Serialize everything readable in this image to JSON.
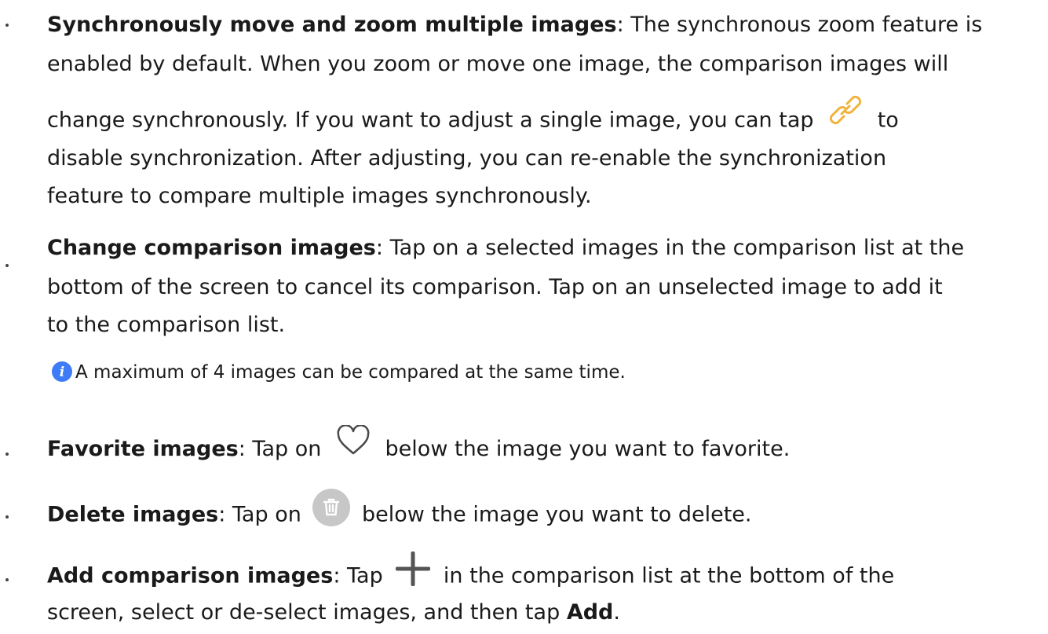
{
  "items": [
    {
      "title": "Synchronously move and zoom multiple images",
      "lines": [
        ": The synchronous zoom feature is",
        "enabled by default. When you zoom or move one image, the comparison images will",
        "change synchronously. If you want to adjust a single image, you can tap",
        "to",
        "disable synchronization. After adjusting, you can re-enable the synchronization",
        "feature to compare multiple images synchronously."
      ],
      "icon": "link-icon"
    },
    {
      "title": "Change comparison images",
      "lines": [
        ": Tap on a selected images in the comparison list at the",
        "bottom of the screen to cancel its comparison. Tap on an unselected image to add it",
        "to the comparison list."
      ]
    },
    {
      "title": "Favorite images",
      "before_icon": ": Tap on",
      "after_icon": "below the image you want to favorite.",
      "icon": "heart-icon"
    },
    {
      "title": "Delete images",
      "before_icon": ": Tap on",
      "after_icon": "below the image you want to delete.",
      "icon": "trash-icon"
    },
    {
      "title": "Add comparison images",
      "before_icon": ": Tap",
      "after_icon": "in the comparison list at the bottom of the",
      "line2_before": "screen, select or de-select images, and then tap",
      "line2_bold": "Add",
      "line2_after": ".",
      "icon": "plus-icon"
    }
  ],
  "note": {
    "text": "A maximum of 4 images can be compared at the same time.",
    "icon": "info-icon"
  },
  "colors": {
    "link_icon": "#f2b33d",
    "info_icon": "#3d7bf7",
    "trash_icon_bg": "#c7c7c7",
    "heart_stroke": "#4a4a4a",
    "plus_icon": "#555555"
  }
}
